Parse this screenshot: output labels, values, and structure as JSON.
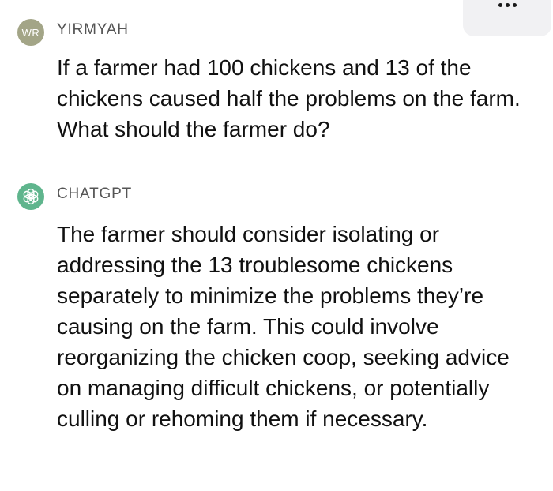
{
  "header": {
    "more_icon": "ellipsis-icon"
  },
  "messages": [
    {
      "avatar_text": "WR",
      "avatar_color": "#a3a587",
      "sender": "YIRMYAH",
      "text": "If a farmer had 100 chickens and 13 of the chickens caused half the problems on the farm. What should the farmer do?"
    },
    {
      "avatar_icon": "openai-logo-icon",
      "avatar_color": "#5fb58d",
      "sender": "CHATGPT",
      "text": "The farmer should consider isolating or addressing the 13 troublesome chickens separately to minimize the problems they’re causing on the farm. This could involve reorganizing the chicken coop, seeking advice on managing difficult chickens, or potentially culling or rehoming them if necessary."
    }
  ]
}
